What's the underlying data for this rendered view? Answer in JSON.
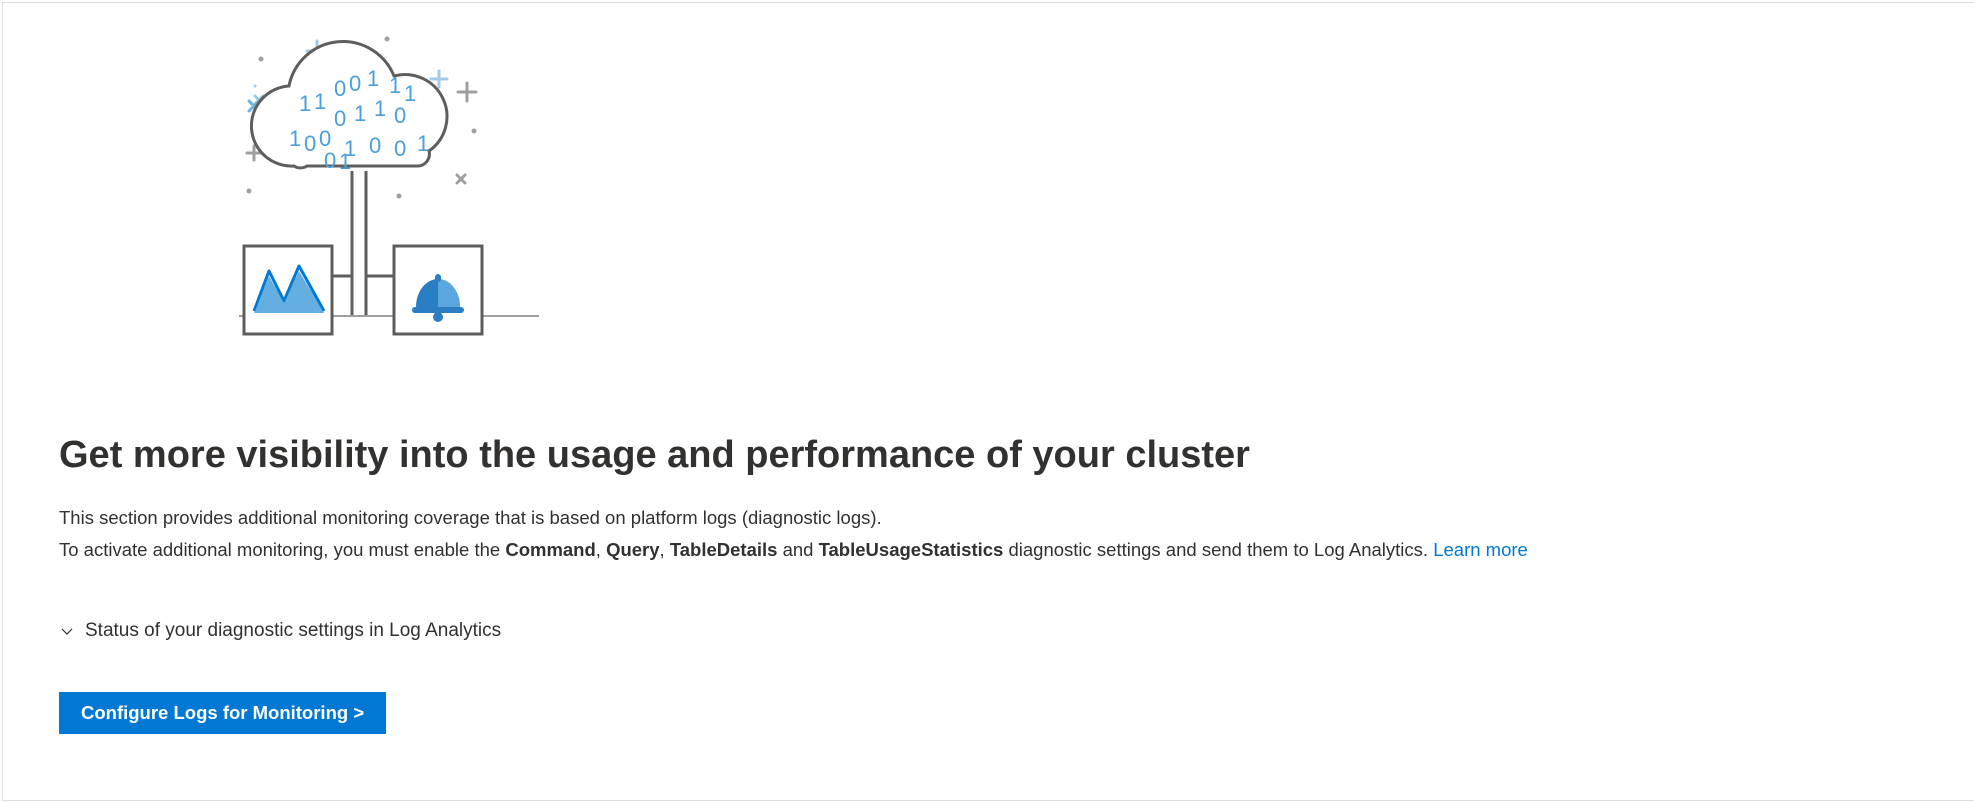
{
  "heading": "Get more visibility into the usage and performance of your cluster",
  "desc_line1": "This section provides additional monitoring coverage that is based on platform logs (diagnostic logs).",
  "desc_line2_pre": "To activate additional monitoring, you must enable the ",
  "desc_bold1": "Command",
  "desc_sep1": ", ",
  "desc_bold2": "Query",
  "desc_sep2": ", ",
  "desc_bold3": "TableDetails",
  "desc_sep3": " and ",
  "desc_bold4": "TableUsageStatistics",
  "desc_line2_post": " diagnostic settings and send them to Log Analytics. ",
  "learn_more": "Learn more",
  "expander_label": "Status of your diagnostic settings in Log Analytics",
  "button_label": "Configure Logs for Monitoring >"
}
